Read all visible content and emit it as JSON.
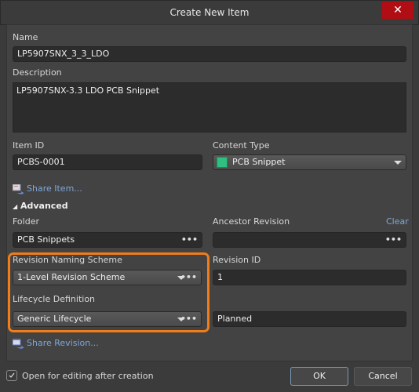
{
  "window": {
    "title": "Create New Item",
    "close_icon": "close-icon"
  },
  "name": {
    "label": "Name",
    "value": "LP5907SNX_3_3_LDO"
  },
  "description": {
    "label": "Description",
    "value": "LP5907SNX-3.3 LDO PCB Snippet"
  },
  "item_id": {
    "label": "Item ID",
    "value": "PCBS-0001"
  },
  "content_type": {
    "label": "Content Type",
    "value": "PCB Snippet",
    "icon": "pcb-snippet-icon"
  },
  "share_item": {
    "label": "Share Item...",
    "icon": "share-icon"
  },
  "advanced": {
    "label": "Advanced",
    "expanded": true
  },
  "folder": {
    "label": "Folder",
    "value": "PCB Snippets",
    "browse": "•••"
  },
  "ancestor_revision": {
    "label": "Ancestor Revision",
    "value": "",
    "clear_label": "Clear",
    "browse": "•••"
  },
  "revision_naming_scheme": {
    "label": "Revision Naming Scheme",
    "value": "1-Level Revision Scheme",
    "browse": "•••"
  },
  "revision_id": {
    "label": "Revision ID",
    "value": "1"
  },
  "lifecycle_definition": {
    "label": "Lifecycle Definition",
    "value": "Generic Lifecycle",
    "browse": "•••",
    "state": "Planned"
  },
  "share_revision": {
    "label": "Share Revision...",
    "icon": "share-icon"
  },
  "footer": {
    "open_for_editing": {
      "label": "Open for editing after creation",
      "checked": true
    },
    "ok_label": "OK",
    "cancel_label": "Cancel"
  },
  "colors": {
    "highlight": "#f07c1a",
    "link": "#7fa7d8",
    "close": "#b00e14",
    "content_icon": "#2fbf80"
  }
}
